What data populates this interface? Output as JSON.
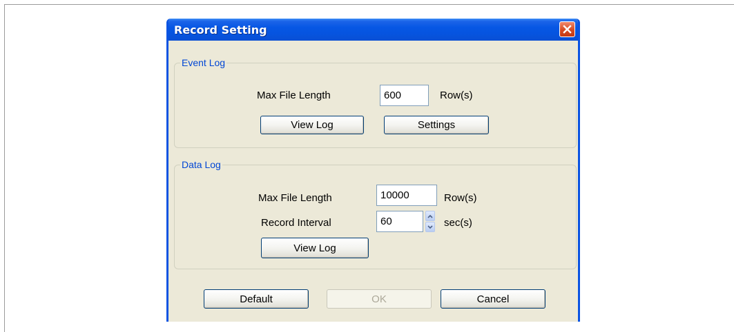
{
  "dialog": {
    "title": "Record Setting"
  },
  "event_log": {
    "legend": "Event Log",
    "max_file_length_label": "Max File Length",
    "max_file_length_value": "600",
    "rows_unit": "Row(s)",
    "view_log_label": "View Log",
    "settings_label": "Settings"
  },
  "data_log": {
    "legend": "Data Log",
    "max_file_length_label": "Max File Length",
    "max_file_length_value": "10000",
    "rows_unit": "Row(s)",
    "record_interval_label": "Record Interval",
    "record_interval_value": "60",
    "interval_unit": "sec(s)",
    "view_log_label": "View Log"
  },
  "footer": {
    "default_label": "Default",
    "ok_label": "OK",
    "cancel_label": "Cancel"
  },
  "colors": {
    "titlebar": "#0757e4",
    "dialog_bg": "#ece9d8",
    "legend_text": "#0046d5",
    "close_button": "#d64a22"
  },
  "icons": {
    "close": "close-icon",
    "spin_up": "spin-up-icon",
    "spin_down": "spin-down-icon"
  }
}
